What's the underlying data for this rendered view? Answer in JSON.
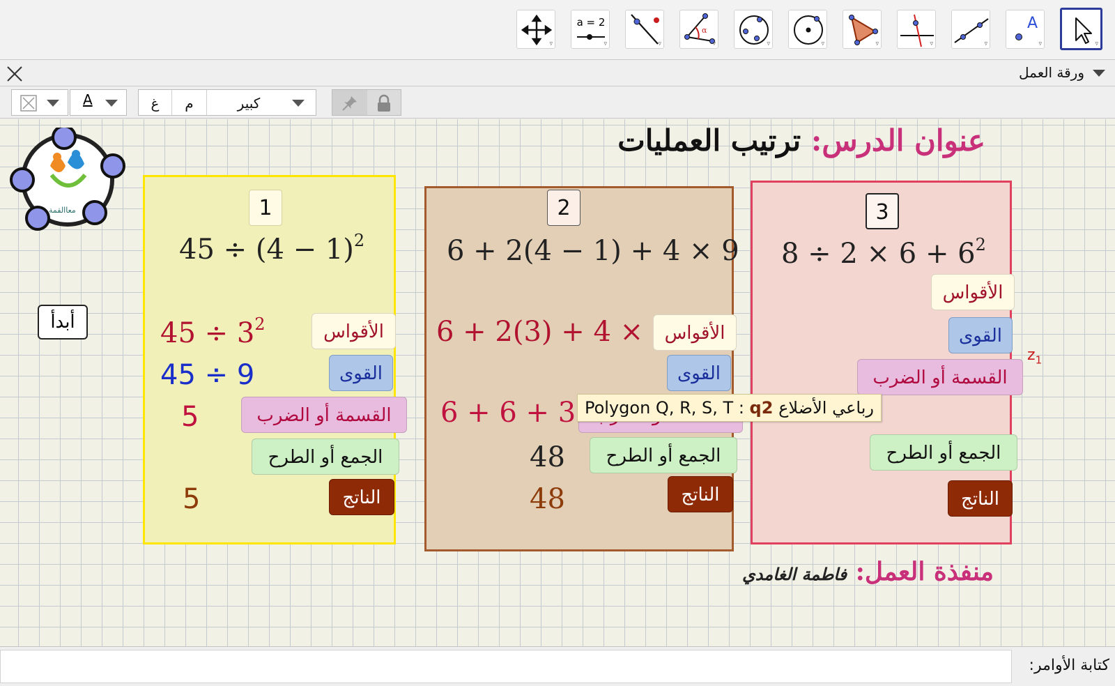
{
  "toolbar": {
    "tools": [
      {
        "name": "move-graphics-view-tool",
        "icon": "move-arrows-icon",
        "label": ""
      },
      {
        "name": "slider-tool",
        "icon": "slider-icon",
        "label": "a = 2"
      },
      {
        "name": "perpendicular-line-tool",
        "icon": "perpendicular-line-icon",
        "label": ""
      },
      {
        "name": "angle-tool",
        "icon": "angle-icon",
        "label": "α"
      },
      {
        "name": "circle-through-three-points-tool",
        "icon": "circle-three-points-icon",
        "label": ""
      },
      {
        "name": "circle-center-point-tool",
        "icon": "circle-center-icon",
        "label": ""
      },
      {
        "name": "polygon-tool",
        "icon": "polygon-icon",
        "label": ""
      },
      {
        "name": "perpendicular-bisector-tool",
        "icon": "perpendicular-bisector-icon",
        "label": ""
      },
      {
        "name": "line-tool",
        "icon": "line-through-points-icon",
        "label": ""
      },
      {
        "name": "point-tool",
        "icon": "point-icon",
        "label": "A"
      },
      {
        "name": "move-tool",
        "icon": "cursor-arrow-icon",
        "label": ""
      }
    ]
  },
  "view": {
    "title": "ورقة العمل"
  },
  "stylebar": {
    "size_value": "كبير",
    "bold_label": "غ",
    "italic_label": "م",
    "text_color_label": "A"
  },
  "worksheet": {
    "lesson_label": "عنوان الدرس:",
    "lesson_title": "ترتيب العمليات",
    "author_label": "منفذة العمل:",
    "author_name": "فاطمة الغامدي",
    "start_button": "أبدأ",
    "logo_text": "معاالقمة",
    "z_label": "z",
    "z_sub": "1",
    "labels": {
      "parentheses": "الأقواس",
      "powers": "القوى",
      "mul_div": "القسمة أو الضرب",
      "add_sub": "الجمع أو الطرح",
      "result": "الناتج"
    },
    "panels": [
      {
        "number": "1",
        "expression": {
          "base": "45 ÷ (4 − 1)",
          "power": "2"
        },
        "step_parentheses": {
          "base": "45 ÷ 3",
          "power": "2"
        },
        "step_powers": "45 ÷ 9",
        "step_mul_div": "5",
        "step_add_sub": "",
        "result": "5"
      },
      {
        "number": "2",
        "expression": {
          "base": "6 + 2(4 − 1) + 4 × 9",
          "power": ""
        },
        "step_parentheses": {
          "base": "6 + 2(3) + 4 × 9",
          "power": ""
        },
        "step_powers": "",
        "step_mul_div": "6 + 6 + 36",
        "step_add_sub": "48",
        "result": "48"
      },
      {
        "number": "3",
        "expression": {
          "base": "8 ÷ 2 × 6 + 6",
          "power": "2"
        },
        "step_parentheses": {
          "base": "",
          "power": ""
        },
        "step_powers": "",
        "step_mul_div": "",
        "step_add_sub": "",
        "result": ""
      }
    ]
  },
  "tooltip": {
    "type": "رباعي الأضلاع",
    "name": "q2",
    "value": "Polygon Q, R, S, T"
  },
  "inputbar": {
    "label": "كتابة الأوامر:",
    "value": ""
  },
  "colors": {
    "panel1_fill": "#f0f0b8",
    "panel1_border": "#ffe600",
    "panel2_fill": "#e2cfb6",
    "panel2_border": "#a35a2c",
    "panel3_fill": "#f2d6cf",
    "panel3_border": "#e0415e",
    "heading_pink": "#c9307a",
    "step_red": "#b0122f",
    "step_blue": "#1a2fc9",
    "step_brown": "#8e3b0a",
    "selected_tool_border": "#2d3c9b"
  }
}
